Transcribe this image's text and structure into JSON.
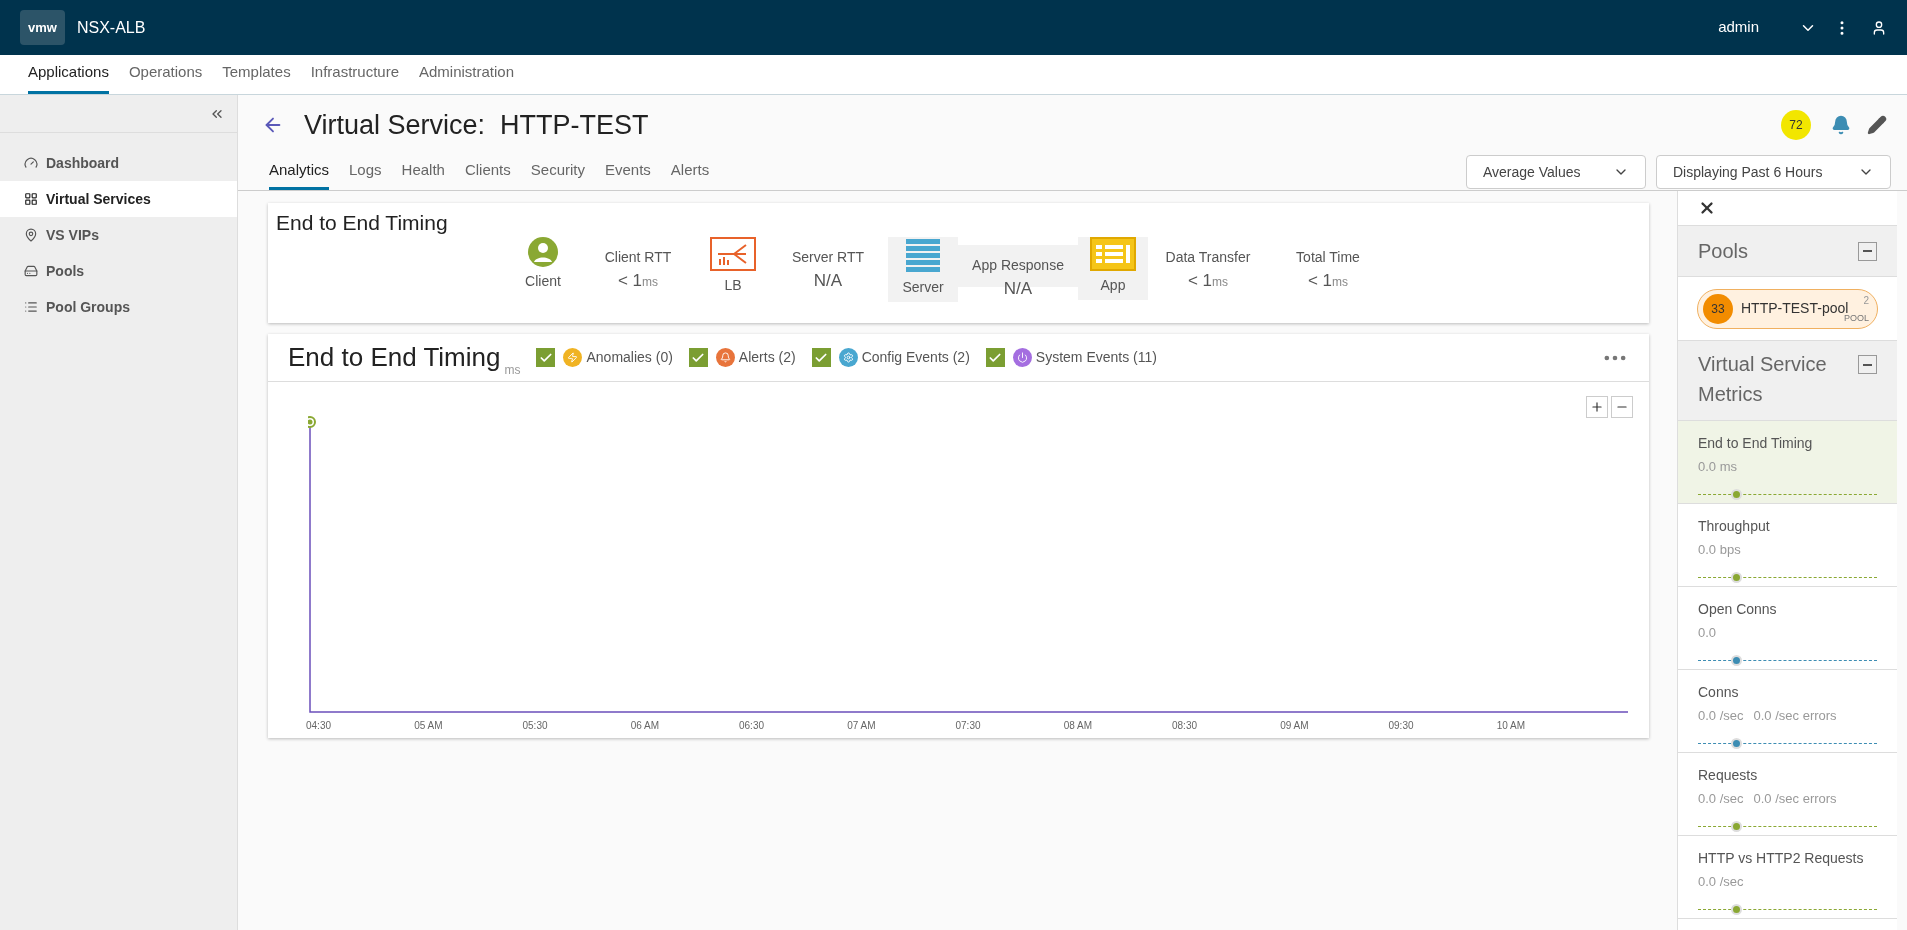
{
  "header": {
    "logo": "vmw",
    "product": "NSX-ALB",
    "user": "admin"
  },
  "nav": [
    {
      "label": "Applications",
      "selected": true
    },
    {
      "label": "Operations",
      "selected": false
    },
    {
      "label": "Templates",
      "selected": false
    },
    {
      "label": "Infrastructure",
      "selected": false
    },
    {
      "label": "Administration",
      "selected": false
    }
  ],
  "sidebar": {
    "items": [
      {
        "label": "Dashboard",
        "selected": false
      },
      {
        "label": "Virtual Services",
        "selected": true
      },
      {
        "label": "VS VIPs",
        "selected": false
      },
      {
        "label": "Pools",
        "selected": false
      },
      {
        "label": "Pool Groups",
        "selected": false
      }
    ]
  },
  "page": {
    "title": "Virtual Service:  HTTP-TEST",
    "health_score": "72"
  },
  "tabs": [
    {
      "label": "Analytics",
      "selected": true
    },
    {
      "label": "Logs",
      "selected": false
    },
    {
      "label": "Health",
      "selected": false
    },
    {
      "label": "Clients",
      "selected": false
    },
    {
      "label": "Security",
      "selected": false
    },
    {
      "label": "Events",
      "selected": false
    },
    {
      "label": "Alerts",
      "selected": false
    }
  ],
  "dropdowns": [
    {
      "value": "Average Values"
    },
    {
      "value": "Displaying Past 6 Hours"
    }
  ],
  "timing_card": {
    "title": "End to End Timing",
    "steps": [
      {
        "kind": "client",
        "label": "Client"
      },
      {
        "kind": "metric",
        "label": "Client RTT",
        "value": "< 1",
        "unit": "ms"
      },
      {
        "kind": "balancer",
        "label": "LB"
      },
      {
        "kind": "metric",
        "label": "Server RTT",
        "value": "N/A"
      },
      {
        "kind": "server",
        "label": "Server"
      },
      {
        "kind": "response",
        "label": "App Response",
        "value": "N/A"
      },
      {
        "kind": "app",
        "label": "App"
      },
      {
        "kind": "metric",
        "label": "Data Transfer",
        "value": "< 1",
        "unit": "ms"
      },
      {
        "kind": "metric",
        "label": "Total Time",
        "value": "< 1",
        "unit": "ms"
      }
    ]
  },
  "chart_card": {
    "title": "End to End Timing",
    "unit": "ms",
    "filters": [
      {
        "label": "Anomalies (0)",
        "checked": true,
        "color": "#f0b323"
      },
      {
        "label": "Alerts (2)",
        "checked": true,
        "color": "#e8743b"
      },
      {
        "label": "Config Events (2)",
        "checked": true,
        "color": "#49a7d0"
      },
      {
        "label": "System Events (11)",
        "checked": true,
        "color": "#a46ee0"
      }
    ],
    "x_labels": [
      "04:30",
      "05 AM",
      "05:30",
      "06 AM",
      "06:30",
      "07 AM",
      "07:30",
      "08 AM",
      "08:30",
      "09 AM",
      "09:30",
      "10 AM"
    ]
  },
  "right_panel": {
    "pools_title": "Pools",
    "pool": {
      "score": "33",
      "name": "HTTP-TEST-pool",
      "count": "2",
      "tag": "POOL"
    },
    "metrics_title": "Virtual Service Metrics",
    "metrics": [
      {
        "name": "End to End Timing",
        "values": [
          "0.0 ms"
        ],
        "selected": true,
        "color": "#8aa833",
        "level": 0.21
      },
      {
        "name": "Throughput",
        "values": [
          "0.0 bps"
        ],
        "selected": false,
        "color": "#8aa833",
        "level": 0.21
      },
      {
        "name": "Open Conns",
        "values": [
          "0.0"
        ],
        "selected": false,
        "color": "#3d8db3",
        "level": 0.21
      },
      {
        "name": "Conns",
        "values": [
          "0.0 /sec",
          "0.0 /sec errors"
        ],
        "selected": false,
        "color": "#3d8db3",
        "level": 0.21
      },
      {
        "name": "Requests",
        "values": [
          "0.0 /sec",
          "0.0 /sec errors"
        ],
        "selected": false,
        "color": "#8aa833",
        "level": 0.21
      },
      {
        "name": "HTTP vs HTTP2 Requests",
        "values": [
          "0.0 /sec"
        ],
        "selected": false,
        "color": "#8aa833",
        "level": 0.21
      }
    ]
  }
}
